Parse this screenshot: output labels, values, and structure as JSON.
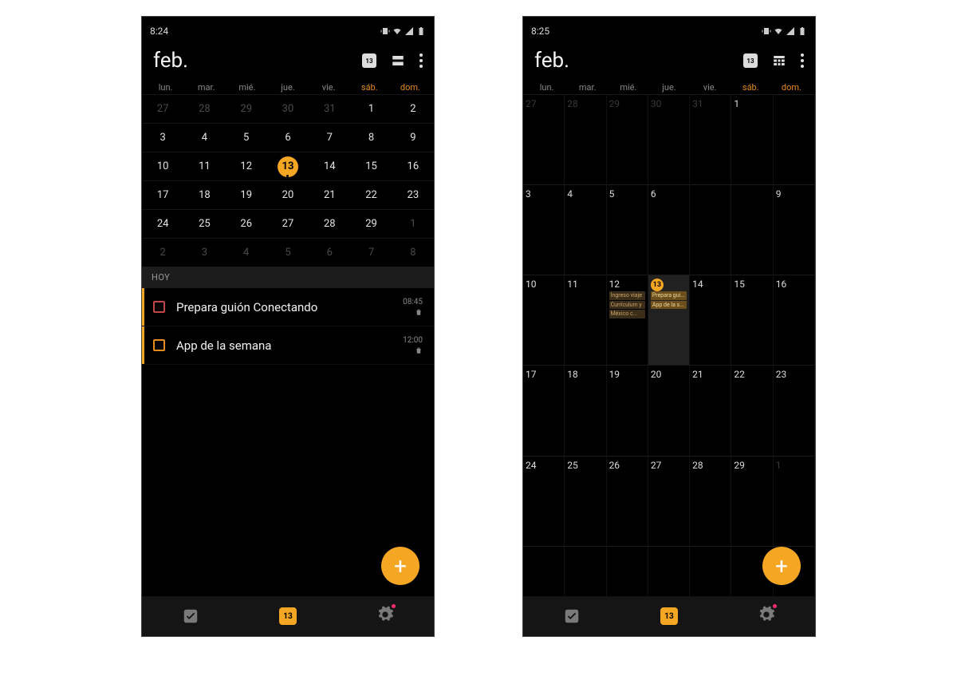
{
  "accent": "#f5a623",
  "screens": {
    "left": {
      "status_time": "8:24",
      "month_label": "feb.",
      "header_today_badge": "13",
      "view_icon": "agenda-lines-icon",
      "weekdays": [
        "lun.",
        "mar.",
        "mié.",
        "jue.",
        "vie.",
        "sáb.",
        "dom."
      ],
      "calendar_rows": [
        [
          {
            "n": "27",
            "dim": true
          },
          {
            "n": "28",
            "dim": true
          },
          {
            "n": "29",
            "dim": true
          },
          {
            "n": "30",
            "dim": true
          },
          {
            "n": "31",
            "dim": true
          },
          {
            "n": "1"
          },
          {
            "n": "2"
          }
        ],
        [
          {
            "n": "3"
          },
          {
            "n": "4"
          },
          {
            "n": "5"
          },
          {
            "n": "6"
          },
          {
            "n": "7"
          },
          {
            "n": "8"
          },
          {
            "n": "9"
          }
        ],
        [
          {
            "n": "10"
          },
          {
            "n": "11"
          },
          {
            "n": "12"
          },
          {
            "n": "13",
            "today": true
          },
          {
            "n": "14"
          },
          {
            "n": "15"
          },
          {
            "n": "16"
          }
        ],
        [
          {
            "n": "17"
          },
          {
            "n": "18"
          },
          {
            "n": "19"
          },
          {
            "n": "20"
          },
          {
            "n": "21"
          },
          {
            "n": "22"
          },
          {
            "n": "23"
          }
        ],
        [
          {
            "n": "24"
          },
          {
            "n": "25"
          },
          {
            "n": "26"
          },
          {
            "n": "27"
          },
          {
            "n": "28"
          },
          {
            "n": "29"
          },
          {
            "n": "1",
            "dim": true
          }
        ],
        [
          {
            "n": "2",
            "dim": true
          },
          {
            "n": "3",
            "dim": true
          },
          {
            "n": "4",
            "dim": true
          },
          {
            "n": "5",
            "dim": true
          },
          {
            "n": "6",
            "dim": true
          },
          {
            "n": "7",
            "dim": true
          },
          {
            "n": "8",
            "dim": true
          }
        ]
      ],
      "section_label": "HOY",
      "tasks": [
        {
          "title": "Prepara guión Conectando",
          "time": "08:45",
          "color": "red"
        },
        {
          "title": "App de la semana",
          "time": "12:00",
          "color": "amber"
        }
      ],
      "nav_date": "13"
    },
    "right": {
      "status_time": "8:25",
      "month_label": "feb.",
      "header_today_badge": "13",
      "view_icon": "month-grid-icon",
      "weekdays": [
        "lun.",
        "mar.",
        "mié.",
        "jue.",
        "vie.",
        "sáb.",
        "dom."
      ],
      "grid": [
        [
          {
            "n": "27",
            "dim": true
          },
          {
            "n": "28",
            "dim": true
          },
          {
            "n": "29",
            "dim": true
          },
          {
            "n": "30",
            "dim": true
          },
          {
            "n": "31",
            "dim": true
          },
          {
            "n": "1"
          },
          {
            "n": ""
          }
        ],
        [
          {
            "n": "3"
          },
          {
            "n": "4"
          },
          {
            "n": "5"
          },
          {
            "n": "6"
          },
          {
            "n": ""
          },
          {
            "n": ""
          },
          {
            "n": "9"
          }
        ],
        [
          {
            "n": "10"
          },
          {
            "n": "11"
          },
          {
            "n": "12",
            "events": [
              {
                "t": "Ingreso viaje",
                "c": "brown"
              },
              {
                "t": "Currículum y",
                "c": "brown"
              },
              {
                "t": "México c...",
                "c": "brown"
              }
            ]
          },
          {
            "n": "13",
            "today": true,
            "selected": true,
            "events": [
              {
                "t": "Prepara gui...",
                "c": "amber"
              },
              {
                "t": "App de la s...",
                "c": "amber"
              }
            ]
          },
          {
            "n": "14"
          },
          {
            "n": "15"
          },
          {
            "n": "16"
          }
        ],
        [
          {
            "n": "17"
          },
          {
            "n": "18"
          },
          {
            "n": "19"
          },
          {
            "n": "20"
          },
          {
            "n": "21"
          },
          {
            "n": "22"
          },
          {
            "n": "23"
          }
        ],
        [
          {
            "n": "24"
          },
          {
            "n": "25"
          },
          {
            "n": "26"
          },
          {
            "n": "27"
          },
          {
            "n": "28"
          },
          {
            "n": "29"
          },
          {
            "n": "1",
            "dim": true
          }
        ],
        [
          {
            "n": ""
          },
          {
            "n": ""
          },
          {
            "n": ""
          },
          {
            "n": ""
          },
          {
            "n": ""
          },
          {
            "n": ""
          },
          {
            "n": ""
          }
        ]
      ],
      "nav_date": "13"
    }
  }
}
